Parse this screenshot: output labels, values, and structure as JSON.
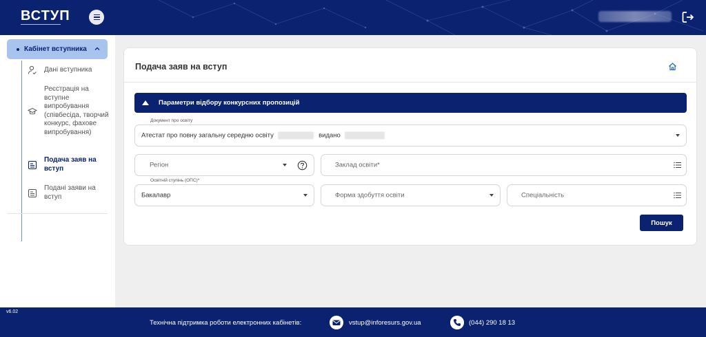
{
  "header": {
    "logo": "ВСТУП",
    "user_name_hidden": ""
  },
  "sidebar": {
    "cabinet_label": "Кабінет вступника",
    "items": [
      {
        "label": "Дані вступника",
        "icon": "user-check-icon"
      },
      {
        "label": "Реєстрація на вступне випробування (співбесіда, творчий конкурс, фахове випробування)",
        "icon": "graduation-cap-icon"
      },
      {
        "label": "Подача заяв на вступ",
        "icon": "document-icon",
        "active": true
      },
      {
        "label": "Подані заяви на вступ",
        "icon": "document-icon"
      }
    ],
    "version": "v6.02"
  },
  "main": {
    "title": "Подача заяв на вступ",
    "accordion_label": "Параметри відбору конкурсних пропозицій",
    "document": {
      "label": "Документ про освіту",
      "value": "Атестат про повну загальну середню освіту",
      "issued_word": "видано"
    },
    "region_placeholder": "Регіон",
    "institution_placeholder": "Заклад освіти*",
    "degree": {
      "label": "Освітній ступінь (ОПС)*",
      "value": "Бакалавр"
    },
    "form_placeholder": "Форма здобуття освіти",
    "specialty_placeholder": "Спеціальність",
    "search_button": "Пошук"
  },
  "footer": {
    "support_label": "Технічна підтримка роботи електронних кабінетів:",
    "email": "vstup@inforesurs.gov.ua",
    "phone": "(044) 290 18 13"
  },
  "colors": {
    "primary": "#0b2270",
    "sidebar_active_bg": "#a9c3ef",
    "background": "#efefef"
  }
}
